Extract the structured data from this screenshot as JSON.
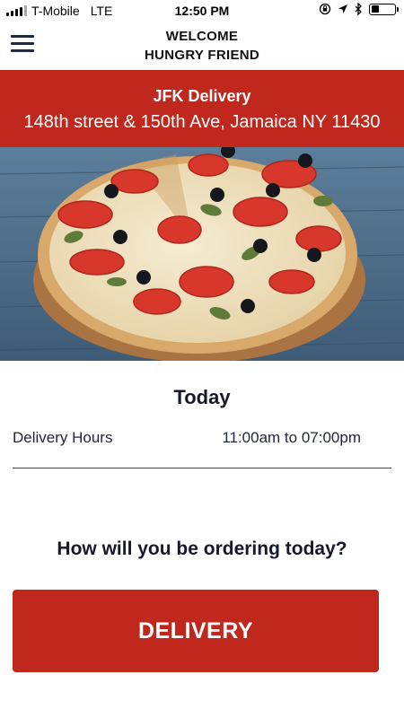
{
  "status_bar": {
    "carrier": "T-Mobile",
    "network": "LTE",
    "time": "12:50 PM",
    "icons": [
      "signal-bars-icon",
      "orientation-lock-icon",
      "location-arrow-icon",
      "bluetooth-icon",
      "battery-icon"
    ],
    "battery_level": 0.35
  },
  "header": {
    "menu_icon": "hamburger-menu-icon",
    "title_line1": "WELCOME",
    "title_line2": "HUNGRY FRIEND"
  },
  "location": {
    "name": "JFK Delivery",
    "address": "148th street & 150th Ave, Jamaica NY 11430"
  },
  "hours": {
    "title": "Today",
    "label": "Delivery Hours",
    "value": "11:00am to 07:00pm"
  },
  "order": {
    "question": "How will you be ordering today?",
    "delivery_label": "DELIVERY"
  },
  "colors": {
    "brand_red": "#c0271d",
    "navy": "#1b2b4a"
  }
}
